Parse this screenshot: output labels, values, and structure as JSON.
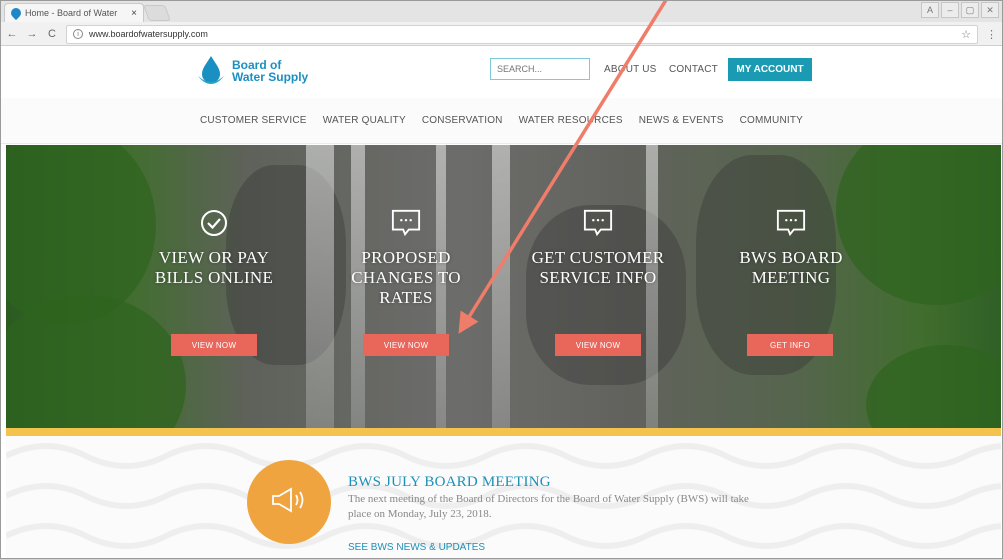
{
  "browser": {
    "tab_title": "Home - Board of Water",
    "tab_close": "×",
    "url": "www.boardofwatersupply.com",
    "back": "←",
    "forward": "→",
    "reload": "C",
    "info": "i",
    "star": "☆",
    "menu": "⋮",
    "window_controls": [
      "A",
      "–",
      "▢",
      "✕"
    ]
  },
  "header": {
    "logo_line1": "Board of",
    "logo_line2": "Water Supply",
    "search_placeholder": "SEARCH...",
    "about": "ABOUT US",
    "contact": "CONTACT",
    "account": "MY ACCOUNT"
  },
  "nav": {
    "items": [
      "CUSTOMER SERVICE",
      "WATER QUALITY",
      "CONSERVATION",
      "WATER RESOURCES",
      "NEWS & EVENTS",
      "COMMUNITY"
    ]
  },
  "hero": {
    "panels": [
      {
        "icon": "checkmark-circle-icon",
        "title": "VIEW OR PAY\nBILLS ONLINE",
        "button": "VIEW NOW"
      },
      {
        "icon": "chat-bubble-icon",
        "title": "PROPOSED\nCHANGES TO\nRATES",
        "button": "VIEW NOW"
      },
      {
        "icon": "chat-bubble-icon",
        "title": "GET CUSTOMER\nSERVICE INFO",
        "button": "VIEW NOW"
      },
      {
        "icon": "chat-bubble-icon",
        "title": "BWS BOARD\nMEETING",
        "button": "GET INFO"
      }
    ]
  },
  "news": {
    "icon": "megaphone-icon",
    "title": "BWS JULY BOARD MEETING",
    "body": "The next meeting of the Board of Directors for the Board of Water Supply (BWS) will take place on Monday, July 23, 2018.",
    "link": "SEE BWS NEWS & UPDATES"
  },
  "colors": {
    "brand_blue": "#1a8fc2",
    "account_teal": "#1b9ab3",
    "button_coral": "#e8665a",
    "gold_bar": "#f3c34e",
    "news_orange": "#f0a440",
    "annotation_arrow": "#f07d6a"
  }
}
